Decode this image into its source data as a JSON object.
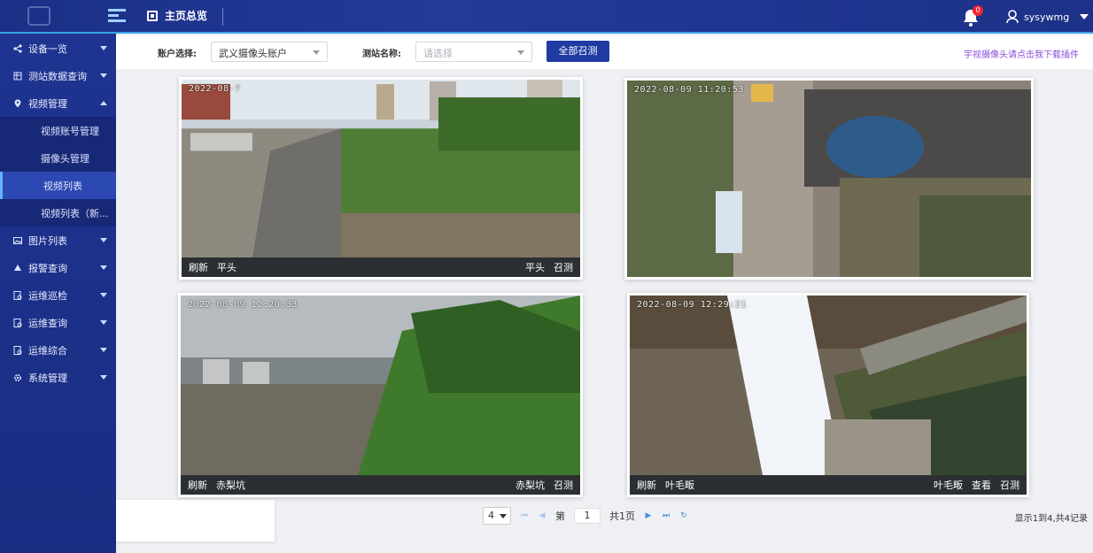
{
  "header": {
    "title": "主页总览",
    "notification_count": "0",
    "username": "sysywmg"
  },
  "sidebar": {
    "items": [
      {
        "label": "设备一览",
        "icon": "share-nodes-icon",
        "expanded": false
      },
      {
        "label": "测站数据查询",
        "icon": "data-table-icon",
        "expanded": false
      },
      {
        "label": "视频管理",
        "icon": "map-pin-icon",
        "expanded": true,
        "children": [
          {
            "label": "视频账号管理",
            "active": false
          },
          {
            "label": "摄像头管理",
            "active": false
          },
          {
            "label": "视频列表",
            "active": true
          },
          {
            "label": "视频列表（新...",
            "active": false
          }
        ]
      },
      {
        "label": "图片列表",
        "icon": "image-icon",
        "expanded": false
      },
      {
        "label": "报警查询",
        "icon": "alarm-icon",
        "expanded": false
      },
      {
        "label": "运维巡检",
        "icon": "inspection-icon",
        "expanded": false
      },
      {
        "label": "运维查询",
        "icon": "search-doc-icon",
        "expanded": false
      },
      {
        "label": "运维综合",
        "icon": "summary-doc-icon",
        "expanded": false
      },
      {
        "label": "系统管理",
        "icon": "gear-icon",
        "expanded": false
      }
    ]
  },
  "filter": {
    "account_label": "账户选择:",
    "account_value": "武义摄像头账户",
    "station_label": "测站名称:",
    "station_placeholder": "请选择",
    "call_all_label": "全部召测",
    "download_link": "宇视摄像头请点击我下载插件"
  },
  "cameras": [
    {
      "timestamp": "2022-08-?",
      "refresh": "刷新",
      "name": "平头",
      "right_label": "平头",
      "call": "召测"
    },
    {
      "timestamp": "2022-08-09 11:20:53",
      "refresh": "",
      "name": "",
      "right_label": "",
      "call": ""
    },
    {
      "timestamp": "2022-08-09 12:20:33",
      "refresh": "刷新",
      "name": "赤梨坑",
      "right_label": "赤梨坑",
      "call": "召测"
    },
    {
      "timestamp": "2022-08-09 12:29:21",
      "refresh": "刷新",
      "name": "叶毛畈",
      "right_label": "叶毛畈",
      "view": "查看",
      "call": "召测"
    }
  ],
  "pager": {
    "page_size": "4",
    "page_prefix": "第",
    "page": "1",
    "total_pages": "共1页",
    "summary": "显示1到4,共4记录"
  },
  "colors": {
    "topbar": "#1b2f86",
    "sidebar": "#1f3490",
    "accent": "#3aa4e8",
    "primary_button": "#1f3aa2",
    "link": "#8a4fd8"
  }
}
